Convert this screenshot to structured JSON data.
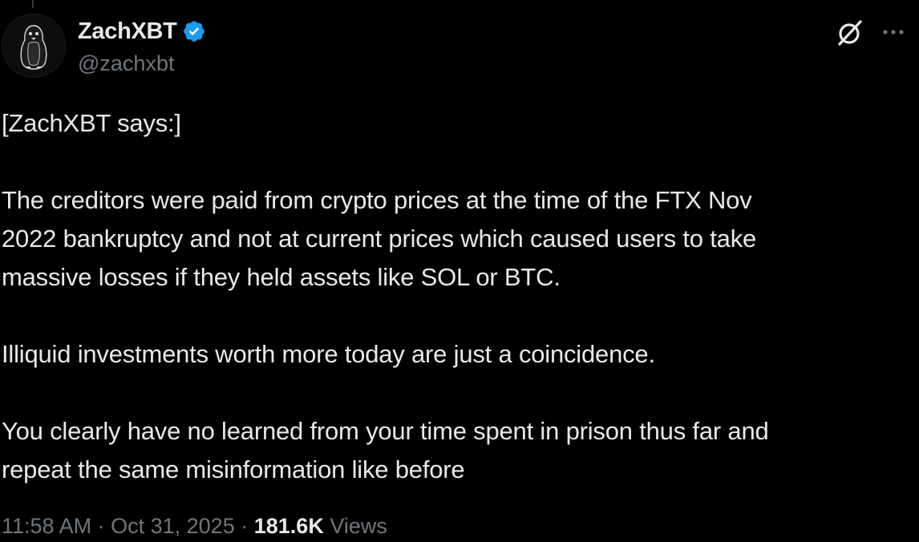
{
  "author": {
    "display_name": "ZachXBT",
    "handle": "@zachxbt",
    "verified": true
  },
  "post": {
    "paragraphs": [
      "[ZachXBT says:]",
      "The creditors were paid from crypto prices at the time of the FTX Nov\n2022 bankruptcy and not at current prices which caused users to take\nmassive losses if they held assets like SOL or BTC.",
      "Illiquid investments worth more today are just a coincidence.",
      "You clearly have no learned from your time spent in prison thus far and\nrepeat the same misinformation like before"
    ]
  },
  "meta": {
    "time": "11:58 AM",
    "separator": "·",
    "date": "Oct 31, 2025",
    "views_count": "181.6K",
    "views_label": "Views"
  },
  "icons": {
    "verified": "verified-badge-icon",
    "grok": "grok-icon",
    "more": "more-options-icon"
  },
  "colors": {
    "background": "#000000",
    "primary_text": "#e7e9ea",
    "secondary_text": "#71767b",
    "verified_blue": "#1d9bf0"
  }
}
